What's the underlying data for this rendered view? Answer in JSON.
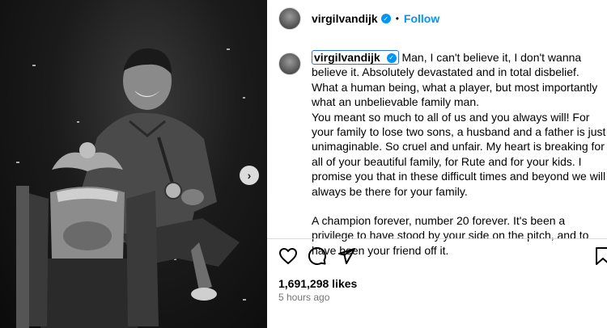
{
  "post": {
    "username": "virgilvandijk",
    "verified": true,
    "separator": "•",
    "follow_label": "Follow",
    "caption": {
      "username": "virgilvandijk",
      "lines": [
        "Man, I can't believe it, I don't wanna believe it. Absolutely devastated and in total disbelief.",
        "What a human being, what a player, but most importantly what an unbelievable family man.",
        "You meant so much to all of us and you always will! For your family to lose two sons, a husband and a father is just unimaginable. So cruel and unfair. My heart is breaking for all of your beautiful family, for Rute and for your kids. I promise you that in these difficult times and beyond we will always be there for your family.",
        "A champion forever, number 20 forever. It's been a privilege to have stood by your side on the pitch, and to have been your friend off it."
      ]
    },
    "likes": "1,691,298 likes",
    "time_ago": "5 hours ago"
  },
  "icons": {
    "like": "heart-icon",
    "comment": "comment-icon",
    "share": "send-icon",
    "save": "bookmark-icon",
    "next": "chevron-right-icon"
  },
  "colors": {
    "accent": "#0095f6",
    "muted": "#737373",
    "divider": "#dbdbdb"
  }
}
